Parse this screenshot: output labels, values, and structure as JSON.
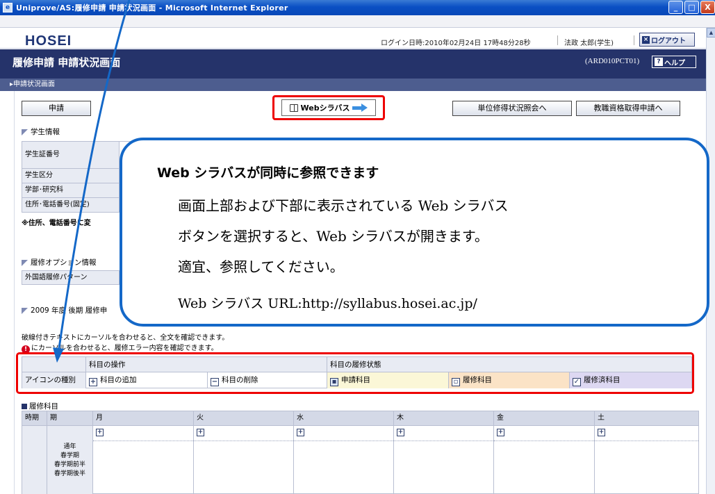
{
  "window": {
    "title": "Uniprove/AS:履修申請 申請状況画面 - Microsoft Internet Explorer",
    "min": "_",
    "max": "□",
    "close": "X"
  },
  "header": {
    "logo": "HOSEI",
    "login_info": "ログイン日時:2010年02月24日 17時48分28秒",
    "user": "法政 太郎(学生)",
    "logout_label": "ログアウト"
  },
  "page": {
    "title": "履修申請 申請状況画面",
    "code": "(ARD010PCT01)",
    "help_label": "ヘルプ",
    "breadcrumb": "▸申請状況画面"
  },
  "buttons": {
    "apply": "申請",
    "web_syllabus": "Webシラバス",
    "credit_status": "単位修得状況照会へ",
    "teaching_license": "教職資格取得申請へ"
  },
  "student_info": {
    "heading": "学生情報",
    "rows": [
      "学生証番号",
      "学生区分",
      "学部･研究科",
      "住所･電話番号(固定)"
    ],
    "note": "※住所、電話番号に変"
  },
  "option_info": {
    "heading": "履修オプション情報",
    "rows": [
      "外国語履修パターン"
    ]
  },
  "term_heading": "2009 年度 後期 履修申",
  "hints": {
    "hover_text": "破線付きテキストにカーソルを合わせると、全文を確認できます。",
    "error_text": "にカーソルを合わせると、履修エラー内容を確認できます。"
  },
  "legend": {
    "header_ops": "科目の操作",
    "header_status": "科目の履修状態",
    "row_label": "アイコンの種別",
    "add": "科目の追加",
    "remove": "科目の削除",
    "applied": "申請科目",
    "enrolled": "履修科目",
    "completed": "履修済科目"
  },
  "timetable": {
    "heading": "履修科目",
    "col_time": "時期",
    "col_period": "期",
    "days": [
      "月",
      "火",
      "水",
      "木",
      "金",
      "土"
    ],
    "term_labels": [
      "通年",
      "春学期",
      "春学期前半",
      "春学期後半"
    ]
  },
  "callout": {
    "title": "Web シラバスが同時に参照できます",
    "line1": "画面上部および下部に表示されている Web シラバス",
    "line2": "ボタンを選択すると、Web シラバスが開きます。",
    "line3": "適宜、参照してください。",
    "url_line": "Web シラバス URL:http://syllabus.hosei.ac.jp/"
  }
}
